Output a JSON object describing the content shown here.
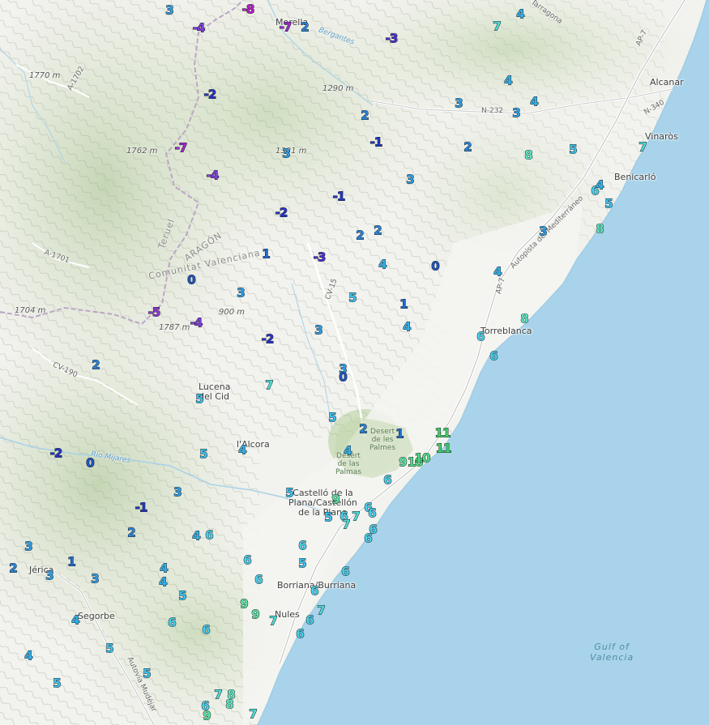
{
  "colors": {
    "sea": "#a8d3ea",
    "land": "#f2f2ee",
    "minus8": "#b51dc9",
    "minus7": "#9f2bd4",
    "minus5": "#8e3ad6",
    "minus4": "#7c3fd6",
    "minus3": "#4b2fcf",
    "minus2": "#2935c8",
    "minus1": "#1f3ac2",
    "zero": "#1f55c2",
    "one": "#226cd0",
    "two": "#2a86dc",
    "three": "#2f9ee6",
    "four": "#32b0ea",
    "five": "#3cc1ee",
    "six": "#47cfeb",
    "seven": "#4fdcd9",
    "eight": "#5ee6c2",
    "nine": "#58e3a5",
    "ten": "#4fdc86",
    "eleven": "#3fd26c"
  },
  "places": [
    {
      "id": "morella",
      "label": "Morella"
    },
    {
      "id": "alcanar",
      "label": "Alcanar"
    },
    {
      "id": "vinaros",
      "label": "Vinaròs"
    },
    {
      "id": "benicarlo",
      "label": "Benicarló"
    },
    {
      "id": "torreblanca",
      "label": "Torreblanca"
    },
    {
      "id": "lucena",
      "label": "Lucena\ndel Cid"
    },
    {
      "id": "alcora",
      "label": "l'Alcora"
    },
    {
      "id": "castello",
      "label": "Castelló de la\nPlana/Castellón\nde la Plana"
    },
    {
      "id": "burriana",
      "label": "Borriana/Burriana"
    },
    {
      "id": "nules",
      "label": "Nules"
    },
    {
      "id": "segorbe",
      "label": "Segorbe"
    },
    {
      "id": "jerica",
      "label": "Jérica"
    }
  ],
  "elevations": [
    "1770 m",
    "1290 m",
    "1762 m",
    "1381 m",
    "1704 m",
    "900 m",
    "1787 m"
  ],
  "roads": [
    "A-1702",
    "N-232",
    "N-340",
    "AP-7",
    "A-1701",
    "CV-15",
    "CV-190",
    "Autopista del Mediterráneo",
    "Autovía Mudéjar",
    "Tarragona",
    "Bergantes",
    "Río Mijares"
  ],
  "regions": [
    "Teruel",
    "ARAGÓN",
    "Comunitat Valenciana"
  ],
  "parks": [
    "Desert\nde les\nPalmes",
    "Desert\nde las\nPalmas"
  ],
  "sea_label": "Gulf of\nValencia",
  "temperatures": [
    {
      "v": "3",
      "c": "three"
    },
    {
      "v": "-8",
      "c": "minus8"
    },
    {
      "v": "-4",
      "c": "minus4"
    },
    {
      "v": "-7",
      "c": "minus7"
    },
    {
      "v": "2",
      "c": "two"
    },
    {
      "v": "-3",
      "c": "minus3"
    },
    {
      "v": "7",
      "c": "seven"
    },
    {
      "v": "4",
      "c": "four"
    },
    {
      "v": "-2",
      "c": "minus2"
    },
    {
      "v": "4",
      "c": "four"
    },
    {
      "v": "3",
      "c": "three"
    },
    {
      "v": "4",
      "c": "four"
    },
    {
      "v": "3",
      "c": "three"
    },
    {
      "v": "2",
      "c": "two"
    },
    {
      "v": "-1",
      "c": "minus1"
    },
    {
      "v": "-7",
      "c": "minus7"
    },
    {
      "v": "3",
      "c": "three"
    },
    {
      "v": "2",
      "c": "two"
    },
    {
      "v": "8",
      "c": "eight"
    },
    {
      "v": "5",
      "c": "five"
    },
    {
      "v": "7",
      "c": "seven"
    },
    {
      "v": "-4",
      "c": "minus4"
    },
    {
      "v": "3",
      "c": "three"
    },
    {
      "v": "-1",
      "c": "minus1"
    },
    {
      "v": "6",
      "c": "six"
    },
    {
      "v": "4",
      "c": "four"
    },
    {
      "v": "5",
      "c": "five"
    },
    {
      "v": "-2",
      "c": "minus2"
    },
    {
      "v": "2",
      "c": "two"
    },
    {
      "v": "2",
      "c": "two"
    },
    {
      "v": "3",
      "c": "three"
    },
    {
      "v": "8",
      "c": "eight"
    },
    {
      "v": "1",
      "c": "one"
    },
    {
      "v": "-3",
      "c": "minus3"
    },
    {
      "v": "4",
      "c": "four"
    },
    {
      "v": "0",
      "c": "zero"
    },
    {
      "v": "4",
      "c": "four"
    },
    {
      "v": "0",
      "c": "zero"
    },
    {
      "v": "3",
      "c": "three"
    },
    {
      "v": "5",
      "c": "five"
    },
    {
      "v": "1",
      "c": "one"
    },
    {
      "v": "-5",
      "c": "minus5"
    },
    {
      "v": "-4",
      "c": "minus4"
    },
    {
      "v": "8",
      "c": "eight"
    },
    {
      "v": "-2",
      "c": "minus2"
    },
    {
      "v": "3",
      "c": "three"
    },
    {
      "v": "4",
      "c": "four"
    },
    {
      "v": "6",
      "c": "six"
    },
    {
      "v": "6",
      "c": "six"
    },
    {
      "v": "2",
      "c": "two"
    },
    {
      "v": "3",
      "c": "three"
    },
    {
      "v": "0",
      "c": "zero"
    },
    {
      "v": "7",
      "c": "seven"
    },
    {
      "v": "5",
      "c": "five"
    },
    {
      "v": "5",
      "c": "five"
    },
    {
      "v": "2",
      "c": "two"
    },
    {
      "v": "1",
      "c": "one"
    },
    {
      "v": "11",
      "c": "eleven"
    },
    {
      "v": "-2",
      "c": "minus2"
    },
    {
      "v": "5",
      "c": "five"
    },
    {
      "v": "4",
      "c": "four"
    },
    {
      "v": "4",
      "c": "four"
    },
    {
      "v": "11",
      "c": "eleven"
    },
    {
      "v": "0",
      "c": "zero"
    },
    {
      "v": "9",
      "c": "nine"
    },
    {
      "v": "10",
      "c": "ten"
    },
    {
      "v": "10",
      "c": "ten"
    },
    {
      "v": "6",
      "c": "six"
    },
    {
      "v": "3",
      "c": "three"
    },
    {
      "v": "5",
      "c": "five"
    },
    {
      "v": "9",
      "c": "nine"
    },
    {
      "v": "-1",
      "c": "minus1"
    },
    {
      "v": "5",
      "c": "five"
    },
    {
      "v": "6",
      "c": "six"
    },
    {
      "v": "7",
      "c": "seven"
    },
    {
      "v": "6",
      "c": "six"
    },
    {
      "v": "2",
      "c": "two"
    },
    {
      "v": "4",
      "c": "four"
    },
    {
      "v": "6",
      "c": "six"
    },
    {
      "v": "7",
      "c": "seven"
    },
    {
      "v": "6",
      "c": "six"
    },
    {
      "v": "3",
      "c": "three"
    },
    {
      "v": "6",
      "c": "six"
    },
    {
      "v": "6",
      "c": "six"
    },
    {
      "v": "6",
      "c": "six"
    },
    {
      "v": "5",
      "c": "five"
    },
    {
      "v": "2",
      "c": "two"
    },
    {
      "v": "1",
      "c": "one"
    },
    {
      "v": "4",
      "c": "four"
    },
    {
      "v": "3",
      "c": "three"
    },
    {
      "v": "3",
      "c": "three"
    },
    {
      "v": "6",
      "c": "six"
    },
    {
      "v": "4",
      "c": "four"
    },
    {
      "v": "6",
      "c": "six"
    },
    {
      "v": "5",
      "c": "five"
    },
    {
      "v": "6",
      "c": "six"
    },
    {
      "v": "6",
      "c": "six"
    },
    {
      "v": "9",
      "c": "nine"
    },
    {
      "v": "9",
      "c": "nine"
    },
    {
      "v": "7",
      "c": "seven"
    },
    {
      "v": "7",
      "c": "seven"
    },
    {
      "v": "4",
      "c": "four"
    },
    {
      "v": "6",
      "c": "six"
    },
    {
      "v": "6",
      "c": "six"
    },
    {
      "v": "6",
      "c": "six"
    },
    {
      "v": "6",
      "c": "six"
    },
    {
      "v": "4",
      "c": "four"
    },
    {
      "v": "5",
      "c": "five"
    },
    {
      "v": "5",
      "c": "five"
    },
    {
      "v": "5",
      "c": "five"
    },
    {
      "v": "7",
      "c": "seven"
    },
    {
      "v": "8",
      "c": "eight"
    },
    {
      "v": "8",
      "c": "eight"
    },
    {
      "v": "6",
      "c": "six"
    },
    {
      "v": "9",
      "c": "nine"
    },
    {
      "v": "7",
      "c": "seven"
    }
  ]
}
